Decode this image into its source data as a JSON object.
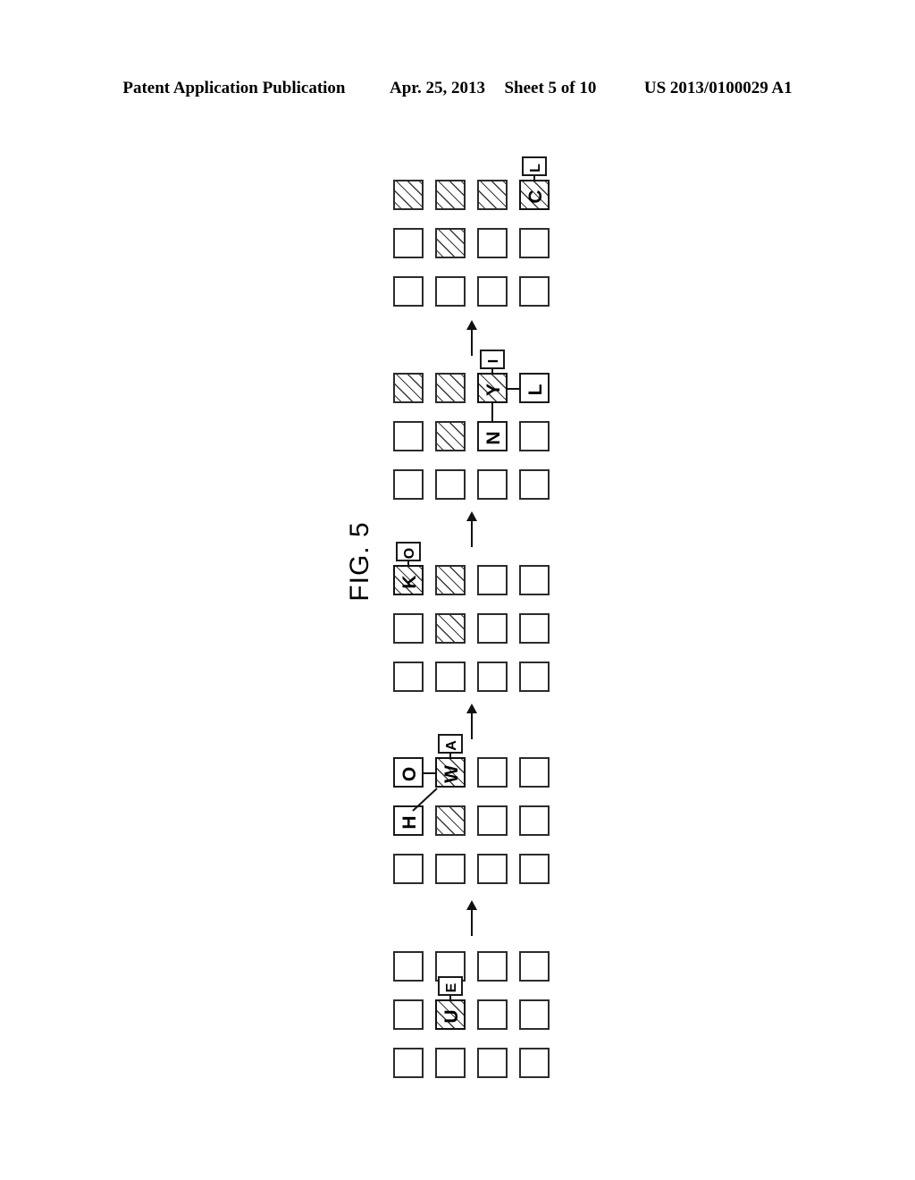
{
  "header": {
    "publication": "Patent Application Publication",
    "date": "Apr. 25, 2013",
    "sheet": "Sheet 5 of 10",
    "patent_number": "US 2013/0100029 A1"
  },
  "figure": {
    "caption": "FIG. 5",
    "orientation_deg": -90,
    "panel_count": 5,
    "grid": {
      "columns": 4,
      "rows": 3
    },
    "arrow_count": 4,
    "arrow_direction": "up",
    "colors": {
      "ink": "#111111",
      "cell_border": "#2c2c2c",
      "paper": "#ffffff"
    },
    "panels": [
      {
        "id": "panel-1",
        "order": 1,
        "position": "top",
        "hatched_cells": [
          {
            "row": 0,
            "col": 0
          },
          {
            "row": 0,
            "col": 1
          },
          {
            "row": 0,
            "col": 2
          },
          {
            "row": 0,
            "col": 3
          },
          {
            "row": 1,
            "col": 1
          }
        ],
        "cell_letters": [
          {
            "row": 0,
            "col": 3,
            "letter": "C"
          }
        ],
        "tag_boxes": [
          {
            "row": 0,
            "col": 3,
            "letter": "L",
            "placement": "above"
          }
        ],
        "label_boxes": [],
        "connectors": []
      },
      {
        "id": "panel-2",
        "order": 2,
        "position": "upper-middle",
        "hatched_cells": [
          {
            "row": 0,
            "col": 0
          },
          {
            "row": 0,
            "col": 1
          },
          {
            "row": 0,
            "col": 2
          },
          {
            "row": 1,
            "col": 1
          }
        ],
        "cell_letters": [
          {
            "row": 0,
            "col": 2,
            "letter": "Y"
          }
        ],
        "tag_boxes": [
          {
            "row": 0,
            "col": 2,
            "letter": "I",
            "placement": "above"
          }
        ],
        "label_boxes": [
          {
            "letter": "L",
            "row": 0,
            "col": 3
          },
          {
            "letter": "N",
            "row": 1,
            "col": 2
          }
        ],
        "connectors": [
          {
            "from": "Y",
            "to": "L",
            "type": "horizontal"
          },
          {
            "from": "Y",
            "to": "N",
            "type": "vertical"
          }
        ]
      },
      {
        "id": "panel-3",
        "order": 3,
        "position": "middle",
        "hatched_cells": [
          {
            "row": 0,
            "col": 0
          },
          {
            "row": 0,
            "col": 1
          },
          {
            "row": 1,
            "col": 1
          }
        ],
        "cell_letters": [
          {
            "row": 0,
            "col": 0,
            "letter": "K"
          }
        ],
        "tag_boxes": [
          {
            "row": 0,
            "col": 0,
            "letter": "O",
            "placement": "above"
          }
        ],
        "label_boxes": [],
        "connectors": []
      },
      {
        "id": "panel-4",
        "order": 4,
        "position": "lower-middle",
        "hatched_cells": [
          {
            "row": 0,
            "col": 1
          },
          {
            "row": 1,
            "col": 1
          }
        ],
        "cell_letters": [
          {
            "row": 0,
            "col": 1,
            "letter": "W"
          }
        ],
        "tag_boxes": [
          {
            "row": 0,
            "col": 1,
            "letter": "A",
            "placement": "above"
          }
        ],
        "label_boxes": [
          {
            "letter": "O",
            "row": 0,
            "col": 0
          },
          {
            "letter": "H",
            "row": 1,
            "col": 0
          }
        ],
        "connectors": [
          {
            "from": "W",
            "to": "O",
            "type": "horizontal"
          },
          {
            "from": "W",
            "to": "H",
            "type": "diagonal"
          }
        ]
      },
      {
        "id": "panel-5",
        "order": 5,
        "position": "bottom",
        "hatched_cells": [
          {
            "row": 1,
            "col": 1
          }
        ],
        "cell_letters": [
          {
            "row": 1,
            "col": 1,
            "letter": "U"
          }
        ],
        "tag_boxes": [
          {
            "row": 1,
            "col": 1,
            "letter": "E",
            "placement": "above"
          }
        ],
        "label_boxes": [],
        "connectors": []
      }
    ]
  }
}
